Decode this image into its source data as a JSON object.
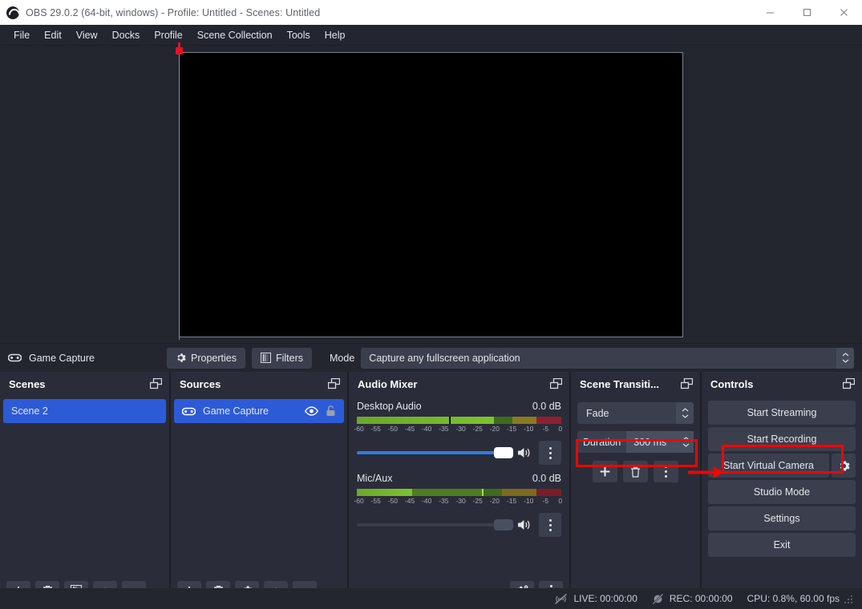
{
  "window": {
    "title": "OBS 29.0.2 (64-bit, windows) - Profile: Untitled - Scenes: Untitled",
    "logo_icon": "obs-logo-icon",
    "minimize_icon": "minimize-icon",
    "maximize_icon": "maximize-icon",
    "close_icon": "close-icon"
  },
  "menubar": {
    "items": [
      {
        "label": "File"
      },
      {
        "label": "Edit"
      },
      {
        "label": "View"
      },
      {
        "label": "Docks"
      },
      {
        "label": "Profile"
      },
      {
        "label": "Scene Collection"
      },
      {
        "label": "Tools"
      },
      {
        "label": "Help"
      }
    ]
  },
  "preview": {
    "canvas_background": "#000000",
    "selection_marker_color": "#e81123"
  },
  "source_toolbar": {
    "source_icon": "gamepad-icon",
    "source_name": "Game Capture",
    "properties_label": "Properties",
    "properties_icon": "gear-icon",
    "filters_label": "Filters",
    "filters_icon": "filters-icon",
    "mode_label": "Mode",
    "mode_value": "Capture any fullscreen application",
    "mode_dropdown_icon": "updown-chevron-icon"
  },
  "scenes": {
    "title": "Scenes",
    "popout_icon": "popout-icon",
    "items": [
      {
        "label": "Scene 2",
        "selected": true
      }
    ],
    "footer": {
      "add_icon": "plus-icon",
      "remove_icon": "trash-icon",
      "filters_icon": "filters-icon",
      "up_icon": "chevron-up-icon",
      "down_icon": "chevron-down-icon"
    }
  },
  "sources": {
    "title": "Sources",
    "popout_icon": "popout-icon",
    "items": [
      {
        "label": "Game Capture",
        "type_icon": "gamepad-icon",
        "visibility_icon": "eye-icon",
        "lock_icon": "unlock-icon",
        "selected": true
      }
    ],
    "footer": {
      "add_icon": "plus-icon",
      "remove_icon": "trash-icon",
      "properties_icon": "gear-icon",
      "up_icon": "chevron-up-icon",
      "down_icon": "chevron-down-icon"
    }
  },
  "audio_mixer": {
    "title": "Audio Mixer",
    "popout_icon": "popout-icon",
    "tick_labels": [
      "-60",
      "-55",
      "-50",
      "-45",
      "-40",
      "-35",
      "-30",
      "-25",
      "-20",
      "-15",
      "-10",
      "-5",
      "0"
    ],
    "tracks": [
      {
        "name": "Desktop Audio",
        "db": "0.0 dB",
        "meter_level_pct": 67,
        "peak_pct": 45,
        "volume_pct": 100,
        "muted": false,
        "mute_icon": "speaker-icon",
        "menu_icon": "vertical-dots-icon"
      },
      {
        "name": "Mic/Aux",
        "db": "0.0 dB",
        "meter_level_pct": 27,
        "peak_pct": 61,
        "volume_pct": 100,
        "muted": true,
        "mute_icon": "speaker-icon",
        "menu_icon": "vertical-dots-icon"
      }
    ],
    "footer": {
      "advanced_icon": "advanced-audio-icon",
      "menu_icon": "vertical-dots-icon"
    }
  },
  "scene_transitions": {
    "title": "Scene Transiti...",
    "popout_icon": "popout-icon",
    "transition_value": "Fade",
    "transition_dropdown_icon": "updown-chevron-icon",
    "duration_label": "Duration",
    "duration_value": "300 ms",
    "duration_spinner_icon": "updown-chevron-icon",
    "add_icon": "plus-icon",
    "remove_icon": "trash-icon",
    "menu_icon": "vertical-dots-icon"
  },
  "controls": {
    "title": "Controls",
    "popout_icon": "popout-icon",
    "buttons": [
      {
        "label": "Start Streaming"
      },
      {
        "label": "Start Recording"
      },
      {
        "label": "Start Virtual Camera"
      },
      {
        "label": "Studio Mode"
      },
      {
        "label": "Settings"
      },
      {
        "label": "Exit"
      }
    ],
    "virtual_camera_settings_icon": "gear-icon"
  },
  "statusbar": {
    "live_icon": "no-broadcast-icon",
    "live_text": "LIVE: 00:00:00",
    "rec_icon": "no-record-icon",
    "rec_text": "REC: 00:00:00",
    "cpu_text": "CPU: 0.8%, 60.00 fps",
    "resize_grip_icon": "resize-grip-icon"
  },
  "annotations": {
    "highlight_color": "#ff0000",
    "highlights": [
      "duration-field",
      "start-recording-button"
    ],
    "arrow_icon": "red-arrow-icon"
  }
}
